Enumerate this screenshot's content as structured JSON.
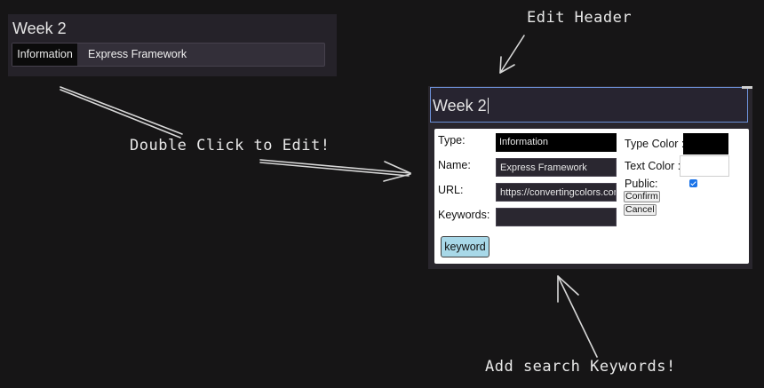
{
  "card": {
    "title": "Week 2",
    "type": "Information",
    "name": "Express Framework"
  },
  "annotations": {
    "edit_header": "Edit Header",
    "double_click": "Double Click to Edit!",
    "add_keywords": "Add search Keywords!"
  },
  "editor": {
    "header_value": "Week 2",
    "labels": {
      "type": "Type:",
      "name": "Name:",
      "url": "URL:",
      "keywords": "Keywords:",
      "type_color": "Type Color :",
      "text_color": "Text Color :",
      "public": "Public:"
    },
    "values": {
      "type": "Information",
      "name": "Express Framework",
      "url": "https://convertingcolors.com",
      "keywords": ""
    },
    "type_color": "#000000",
    "text_color": "#ffffff",
    "public_checked": true,
    "confirm_label": "Confirm",
    "cancel_label": "Cancel",
    "keyword_tag": "keyword"
  }
}
